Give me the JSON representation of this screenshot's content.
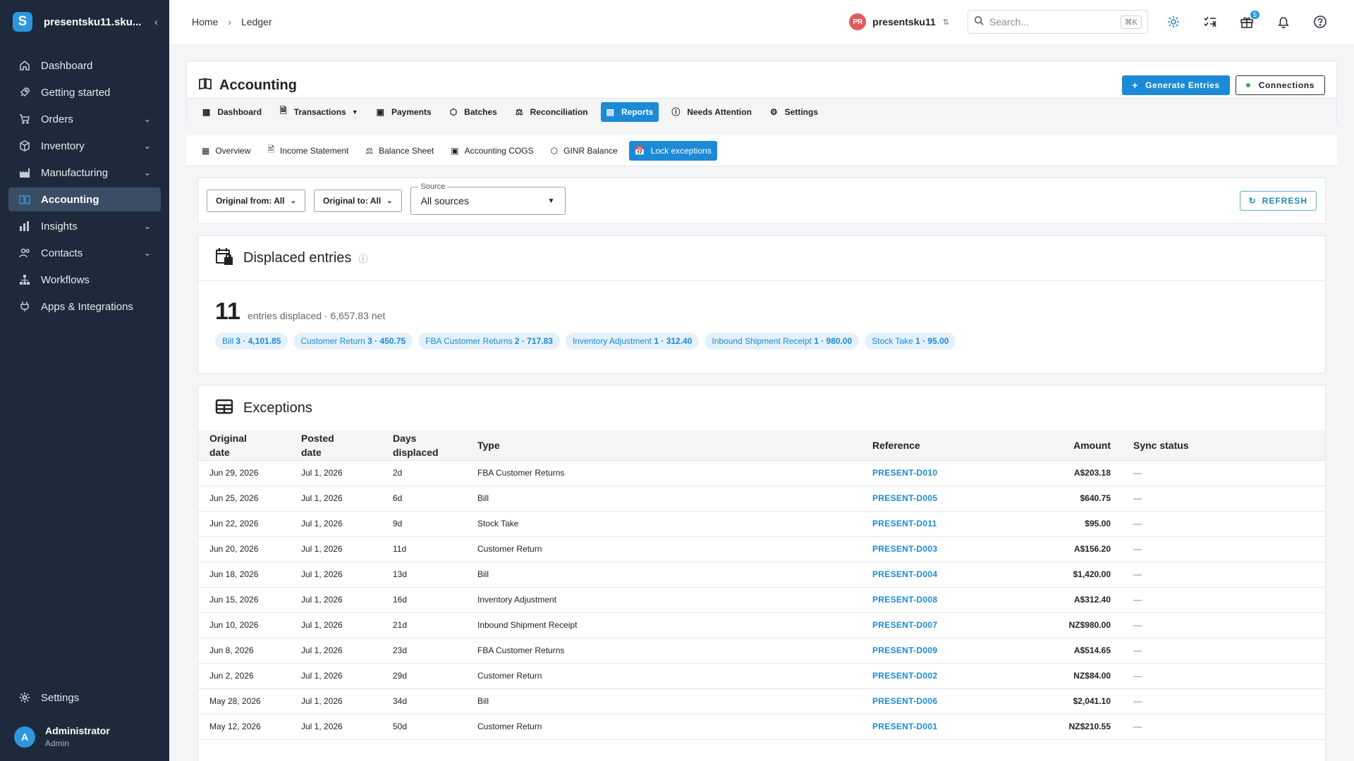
{
  "sidebar": {
    "org_name": "presentsku11.sku...",
    "items": [
      {
        "label": "Dashboard",
        "icon": "home-icon",
        "chevron": false
      },
      {
        "label": "Getting started",
        "icon": "rocket-icon",
        "chevron": false
      },
      {
        "label": "Orders",
        "icon": "cart-icon",
        "chevron": true
      },
      {
        "label": "Inventory",
        "icon": "box-icon",
        "chevron": true
      },
      {
        "label": "Manufacturing",
        "icon": "factory-icon",
        "chevron": true
      },
      {
        "label": "Accounting",
        "icon": "ledger-icon",
        "chevron": false,
        "active": true
      },
      {
        "label": "Insights",
        "icon": "chart-icon",
        "chevron": true
      },
      {
        "label": "Contacts",
        "icon": "people-icon",
        "chevron": true
      },
      {
        "label": "Workflows",
        "icon": "workflow-icon",
        "chevron": false
      },
      {
        "label": "Apps & Integrations",
        "icon": "plug-icon",
        "chevron": false
      }
    ],
    "settings_label": "Settings",
    "user": {
      "initial": "A",
      "name": "Administrator",
      "role": "Admin"
    }
  },
  "topbar": {
    "breadcrumb": [
      "Home",
      "Ledger"
    ],
    "account": {
      "initials": "PR",
      "name": "presentsku11"
    },
    "search": {
      "placeholder": "Search...",
      "shortcut": "⌘K"
    },
    "gift_badge": "5"
  },
  "accounting": {
    "title": "Accounting",
    "generate_label": "Generate Entries",
    "connections_label": "Connections",
    "tabs": [
      {
        "label": "Dashboard"
      },
      {
        "label": "Transactions"
      },
      {
        "label": "Payments"
      },
      {
        "label": "Batches"
      },
      {
        "label": "Reconciliation"
      },
      {
        "label": "Reports",
        "active": true
      },
      {
        "label": "Needs Attention"
      },
      {
        "label": "Settings"
      }
    ],
    "subtabs": [
      {
        "label": "Overview"
      },
      {
        "label": "Income Statement"
      },
      {
        "label": "Balance Sheet"
      },
      {
        "label": "Accounting COGS"
      },
      {
        "label": "GINR Balance"
      },
      {
        "label": "Lock exceptions",
        "active": true
      }
    ]
  },
  "filters": {
    "original_from": "Original from: All",
    "original_to": "Original to: All",
    "source_legend": "Source",
    "source_value": "All sources",
    "refresh_label": "REFRESH"
  },
  "displaced": {
    "title": "Displaced entries",
    "count": "11",
    "summary": "entries displaced · 6,657.83 net",
    "chips": [
      {
        "name": "Bill",
        "value": "3 · 4,101.85"
      },
      {
        "name": "Customer Return",
        "value": "3 · 450.75"
      },
      {
        "name": "FBA Customer Returns",
        "value": "2 · 717.83"
      },
      {
        "name": "Inventory Adjustment",
        "value": "1 · 312.40"
      },
      {
        "name": "Inbound Shipment Receipt",
        "value": "1 · 980.00"
      },
      {
        "name": "Stock Take",
        "value": "1 · 95.00"
      }
    ]
  },
  "exceptions": {
    "title": "Exceptions",
    "columns": {
      "original_date": [
        "Original",
        "date"
      ],
      "posted_date": [
        "Posted",
        "date"
      ],
      "days_displaced": [
        "Days",
        "displaced"
      ],
      "type": "Type",
      "reference": "Reference",
      "amount": "Amount",
      "sync_status": "Sync status"
    },
    "rows": [
      {
        "original": "Jun 29, 2026",
        "posted": "Jul 1, 2026",
        "days": "2d",
        "type": "FBA Customer Returns",
        "ref": "PRESENT-D010",
        "amount": "A$203.18",
        "sync": "—"
      },
      {
        "original": "Jun 25, 2026",
        "posted": "Jul 1, 2026",
        "days": "6d",
        "type": "Bill",
        "ref": "PRESENT-D005",
        "amount": "$640.75",
        "sync": "—"
      },
      {
        "original": "Jun 22, 2026",
        "posted": "Jul 1, 2026",
        "days": "9d",
        "type": "Stock Take",
        "ref": "PRESENT-D011",
        "amount": "$95.00",
        "sync": "—"
      },
      {
        "original": "Jun 20, 2026",
        "posted": "Jul 1, 2026",
        "days": "11d",
        "type": "Customer Return",
        "ref": "PRESENT-D003",
        "amount": "A$156.20",
        "sync": "—"
      },
      {
        "original": "Jun 18, 2026",
        "posted": "Jul 1, 2026",
        "days": "13d",
        "type": "Bill",
        "ref": "PRESENT-D004",
        "amount": "$1,420.00",
        "sync": "—"
      },
      {
        "original": "Jun 15, 2026",
        "posted": "Jul 1, 2026",
        "days": "16d",
        "type": "Inventory Adjustment",
        "ref": "PRESENT-D008",
        "amount": "A$312.40",
        "sync": "—"
      },
      {
        "original": "Jun 10, 2026",
        "posted": "Jul 1, 2026",
        "days": "21d",
        "type": "Inbound Shipment Receipt",
        "ref": "PRESENT-D007",
        "amount": "NZ$980.00",
        "sync": "—"
      },
      {
        "original": "Jun 8, 2026",
        "posted": "Jul 1, 2026",
        "days": "23d",
        "type": "FBA Customer Returns",
        "ref": "PRESENT-D009",
        "amount": "A$514.65",
        "sync": "—"
      },
      {
        "original": "Jun 2, 2026",
        "posted": "Jul 1, 2026",
        "days": "29d",
        "type": "Customer Return",
        "ref": "PRESENT-D002",
        "amount": "NZ$84.00",
        "sync": "—"
      },
      {
        "original": "May 28, 2026",
        "posted": "Jul 1, 2026",
        "days": "34d",
        "type": "Bill",
        "ref": "PRESENT-D006",
        "amount": "$2,041.10",
        "sync": "—"
      },
      {
        "original": "May 12, 2026",
        "posted": "Jul 1, 2026",
        "days": "50d",
        "type": "Customer Return",
        "ref": "PRESENT-D001",
        "amount": "NZ$210.55",
        "sync": "—"
      }
    ]
  },
  "colors": {
    "accent": "#1c8ad6",
    "sidebar_bg": "#1e2a3b",
    "active_nav": "#3b4d64"
  }
}
